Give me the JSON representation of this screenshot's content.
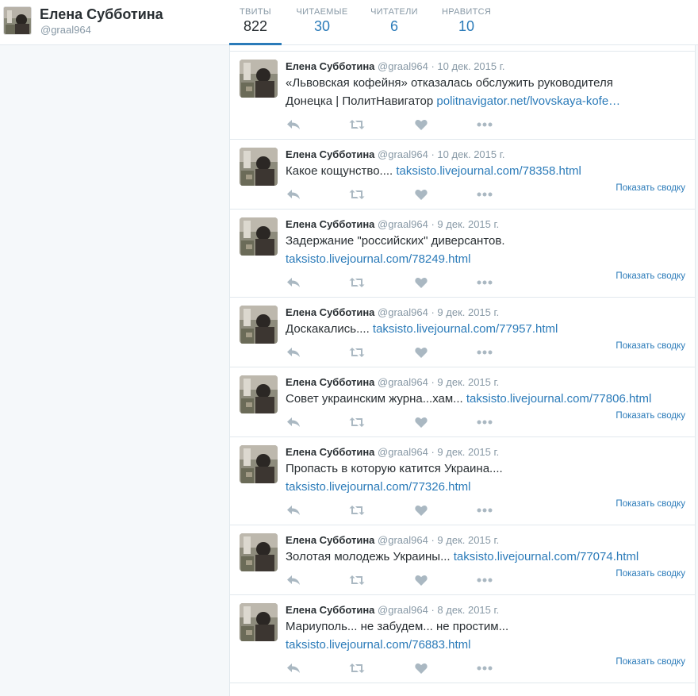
{
  "profile": {
    "name": "Елена Субботина",
    "handle": "@graal964"
  },
  "stats": [
    {
      "label": "ТВИТЫ",
      "value": "822",
      "active": true
    },
    {
      "label": "ЧИТАЕМЫЕ",
      "value": "30",
      "active": false
    },
    {
      "label": "ЧИТАТЕЛИ",
      "value": "6",
      "active": false
    },
    {
      "label": "НРАВИТСЯ",
      "value": "10",
      "active": false
    }
  ],
  "summary_label": "Показать сводку",
  "tweets": [
    {
      "name": "Елена Субботина",
      "handle": "@graal964",
      "date": "10 дек. 2015 г.",
      "lines": [
        {
          "text": "«Львовская кофейня» отказалась обслужить руководителя",
          "link": ""
        },
        {
          "text": "Донецка | ПолитНавигатор ",
          "link": "politnavigator.net/lvovskaya-kofe…"
        }
      ],
      "has_summary": false
    },
    {
      "name": "Елена Субботина",
      "handle": "@graal964",
      "date": "10 дек. 2015 г.",
      "lines": [
        {
          "text": "Какое кощунство.... ",
          "link": "taksisto.livejournal.com/78358.html"
        }
      ],
      "has_summary": true
    },
    {
      "name": "Елена Субботина",
      "handle": "@graal964",
      "date": "9 дек. 2015 г.",
      "lines": [
        {
          "text": "Задержание \"российских\" диверсантов.",
          "link": ""
        },
        {
          "text": "",
          "link": "taksisto.livejournal.com/78249.html"
        }
      ],
      "has_summary": true
    },
    {
      "name": "Елена Субботина",
      "handle": "@graal964",
      "date": "9 дек. 2015 г.",
      "lines": [
        {
          "text": "Доскакались.... ",
          "link": "taksisto.livejournal.com/77957.html"
        }
      ],
      "has_summary": true
    },
    {
      "name": "Елена Субботина",
      "handle": "@graal964",
      "date": "9 дек. 2015 г.",
      "lines": [
        {
          "text": "Совет украинским журна...хам... ",
          "link": "taksisto.livejournal.com/77806.html"
        }
      ],
      "has_summary": true
    },
    {
      "name": "Елена Субботина",
      "handle": "@graal964",
      "date": "9 дек. 2015 г.",
      "lines": [
        {
          "text": "Пропасть в которую катится Украина....",
          "link": ""
        },
        {
          "text": "",
          "link": "taksisto.livejournal.com/77326.html"
        }
      ],
      "has_summary": true
    },
    {
      "name": "Елена Субботина",
      "handle": "@graal964",
      "date": "9 дек. 2015 г.",
      "lines": [
        {
          "text": "Золотая молодежь Украины... ",
          "link": "taksisto.livejournal.com/77074.html"
        }
      ],
      "has_summary": true
    },
    {
      "name": "Елена Субботина",
      "handle": "@graal964",
      "date": "8 дек. 2015 г.",
      "lines": [
        {
          "text": "Мариуполь... не забудем... не простим...",
          "link": ""
        },
        {
          "text": "",
          "link": "taksisto.livejournal.com/76883.html"
        }
      ],
      "has_summary": true
    }
  ],
  "icons": {
    "reply": "reply-icon",
    "retweet": "retweet-icon",
    "like": "heart-icon",
    "more": "more-icon"
  },
  "colors": {
    "link": "#2b7bb9",
    "muted": "#8899a6",
    "text": "#292f33",
    "action": "#aab8c2"
  }
}
